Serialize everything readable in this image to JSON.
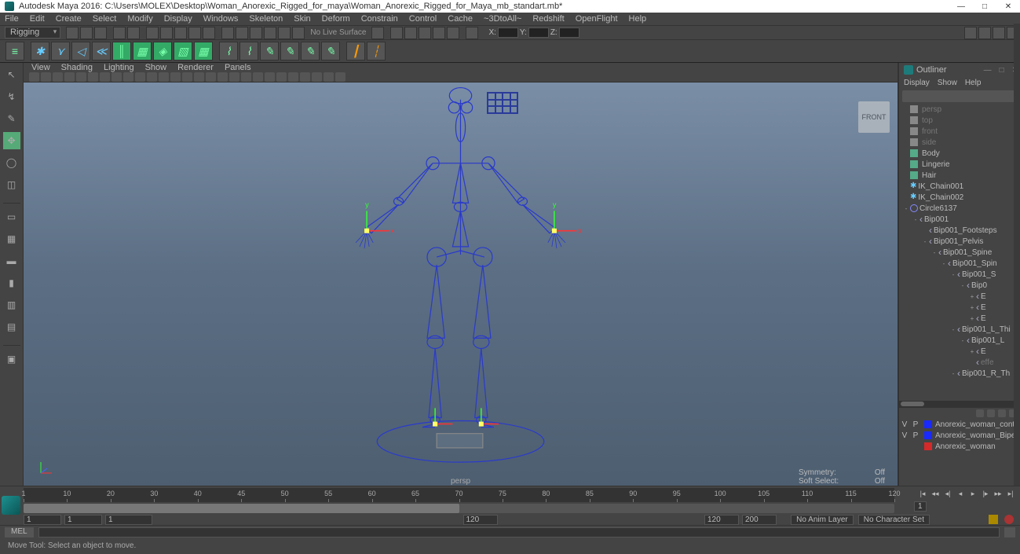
{
  "title_bar": {
    "app": "Autodesk Maya 2016:",
    "path": "C:\\Users\\MOLEX\\Desktop\\Woman_Anorexic_Rigged_for_maya\\Woman_Anorexic_Rigged_for_Maya_mb_standart.mb*"
  },
  "menus": [
    "File",
    "Edit",
    "Create",
    "Select",
    "Modify",
    "Display",
    "Windows",
    "Skeleton",
    "Skin",
    "Deform",
    "Constrain",
    "Control",
    "Cache",
    "~3DtoAll~",
    "Redshift",
    "OpenFlight",
    "Help"
  ],
  "toolbar1": {
    "mode": "Rigging",
    "live_surface": "No Live Surface",
    "xyz": {
      "x": "X:",
      "y": "Y:",
      "z": "Z:"
    }
  },
  "panel_menus": [
    "View",
    "Shading",
    "Lighting",
    "Show",
    "Renderer",
    "Panels"
  ],
  "viewport": {
    "camera": "persp",
    "cube_face": "FRONT",
    "symmetry_label": "Symmetry:",
    "symmetry_val": "Off",
    "softsel_label": "Soft Select:",
    "softsel_val": "Off"
  },
  "outliner": {
    "title": "Outliner",
    "menus": [
      "Display",
      "Show",
      "Help"
    ],
    "items": [
      {
        "ind": 0,
        "type": "cam",
        "label": "persp",
        "dim": true
      },
      {
        "ind": 0,
        "type": "cam",
        "label": "top",
        "dim": true
      },
      {
        "ind": 0,
        "type": "cam",
        "label": "front",
        "dim": true
      },
      {
        "ind": 0,
        "type": "cam",
        "label": "side",
        "dim": true
      },
      {
        "ind": 0,
        "type": "mesh",
        "label": "Body"
      },
      {
        "ind": 0,
        "type": "mesh",
        "label": "Lingerie"
      },
      {
        "ind": 0,
        "type": "mesh",
        "label": "Hair"
      },
      {
        "ind": 0,
        "type": "ik",
        "label": "IK_Chain001"
      },
      {
        "ind": 0,
        "type": "ik",
        "label": "IK_Chain002"
      },
      {
        "ind": 0,
        "type": "circ",
        "label": "Circle6137",
        "exp": "-"
      },
      {
        "ind": 1,
        "type": "joint",
        "label": "Bip001",
        "exp": "-"
      },
      {
        "ind": 2,
        "type": "joint",
        "label": "Bip001_Footsteps"
      },
      {
        "ind": 2,
        "type": "joint",
        "label": "Bip001_Pelvis",
        "exp": "-"
      },
      {
        "ind": 3,
        "type": "joint",
        "label": "Bip001_Spine",
        "exp": "-"
      },
      {
        "ind": 4,
        "type": "joint",
        "label": "Bip001_Spin",
        "exp": "-"
      },
      {
        "ind": 5,
        "type": "joint",
        "label": "Bip001_S",
        "exp": "-"
      },
      {
        "ind": 6,
        "type": "joint",
        "label": "Bip0",
        "exp": "-"
      },
      {
        "ind": 7,
        "type": "joint",
        "label": "E",
        "exp": "+"
      },
      {
        "ind": 7,
        "type": "joint",
        "label": "E",
        "exp": "+"
      },
      {
        "ind": 7,
        "type": "joint",
        "label": "E",
        "exp": "+"
      },
      {
        "ind": 5,
        "type": "joint",
        "label": "Bip001_L_Thi",
        "exp": "-"
      },
      {
        "ind": 6,
        "type": "joint",
        "label": "Bip001_L",
        "exp": "-"
      },
      {
        "ind": 7,
        "type": "joint",
        "label": "E",
        "exp": "+"
      },
      {
        "ind": 7,
        "type": "joint",
        "label": "effe",
        "dim": true
      },
      {
        "ind": 5,
        "type": "joint",
        "label": "Bip001_R_Th",
        "exp": "-"
      }
    ]
  },
  "layers": [
    {
      "v": "V",
      "p": "P",
      "color": "#1a2aff",
      "name": "Anorexic_woman_cont"
    },
    {
      "v": "V",
      "p": "P",
      "color": "#1a2aff",
      "name": "Anorexic_woman_Bipe"
    },
    {
      "v": "",
      "p": "",
      "color": "#d42a2a",
      "name": "Anorexic_woman"
    }
  ],
  "time": {
    "ticks": [
      "1",
      "10",
      "20",
      "30",
      "40",
      "45",
      "50",
      "55",
      "60",
      "65",
      "70",
      "75",
      "80",
      "85",
      "90",
      "95",
      "100",
      "105",
      "110",
      "115",
      "120"
    ],
    "range_start": "1",
    "range_start2": "1",
    "range_end_vis": "1",
    "end1": "120",
    "end2": "120",
    "end3": "200",
    "anim_layer": "No Anim Layer",
    "char_set": "No Character Set",
    "playhead": "1"
  },
  "cmd": {
    "lang": "MEL"
  },
  "help_line": "Move Tool: Select an object to move."
}
